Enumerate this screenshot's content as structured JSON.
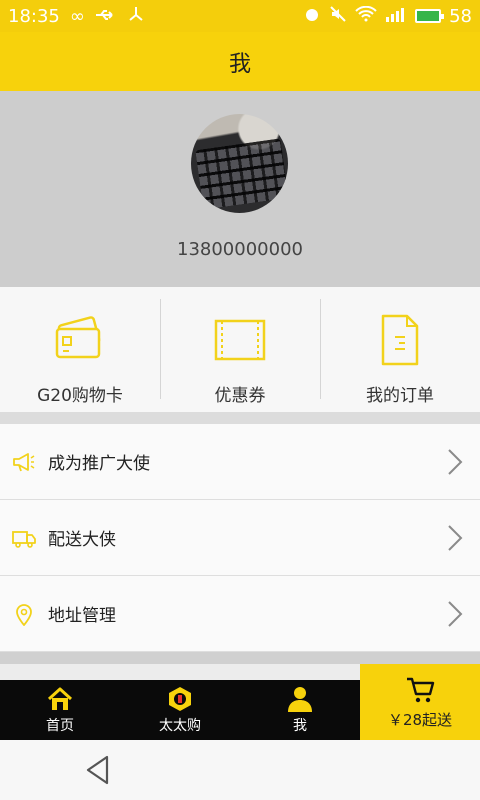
{
  "status_bar": {
    "time": "18:35",
    "battery": "58"
  },
  "header": {
    "title": "我"
  },
  "profile": {
    "phone": "13800000000"
  },
  "quick_menu": [
    {
      "label": "G20购物卡",
      "icon": "card-icon"
    },
    {
      "label": "优惠券",
      "icon": "coupon-icon"
    },
    {
      "label": "我的订单",
      "icon": "order-icon"
    }
  ],
  "menu_list": [
    {
      "label": "成为推广大使",
      "icon": "megaphone-icon"
    },
    {
      "label": "配送大侠",
      "icon": "truck-icon"
    },
    {
      "label": "地址管理",
      "icon": "location-pin-icon"
    }
  ],
  "tabs": [
    {
      "label": "首页",
      "icon": "home-icon"
    },
    {
      "label": "太太购",
      "icon": "shop-badge-icon"
    },
    {
      "label": "我",
      "icon": "user-icon"
    }
  ],
  "cart": {
    "label": "￥28起送",
    "icon": "cart-icon"
  },
  "colors": {
    "accent": "#f7d20c",
    "tabbar": "#0a0a0a"
  }
}
